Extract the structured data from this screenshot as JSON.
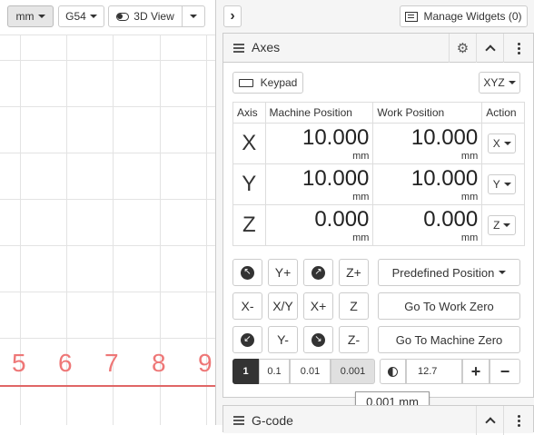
{
  "toolbar": {
    "units": "mm",
    "wcs": "G54",
    "view": "3D View"
  },
  "viewport": {
    "axis_numbers": [
      "5",
      "6",
      "7",
      "8",
      "9"
    ]
  },
  "panel_toggle": "›",
  "manage_widgets": "Manage Widgets (0)",
  "axes_widget": {
    "title": "Axes",
    "keypad": "Keypad",
    "axis_select": "XYZ",
    "table": {
      "headers": [
        "Axis",
        "Machine Position",
        "Work Position",
        "Action"
      ],
      "rows": [
        {
          "axis": "X",
          "machine": "10.000",
          "work": "10.000",
          "unit": "mm",
          "action": "X"
        },
        {
          "axis": "Y",
          "machine": "10.000",
          "work": "10.000",
          "unit": "mm",
          "action": "Y"
        },
        {
          "axis": "Z",
          "machine": "0.000",
          "work": "0.000",
          "unit": "mm",
          "action": "Z"
        }
      ]
    },
    "jog": {
      "y_plus": "Y+",
      "z_plus": "Z+",
      "x_minus": "X-",
      "xy": "X/Y",
      "x_plus": "X+",
      "z": "Z",
      "y_minus": "Y-",
      "z_minus": "Z-"
    },
    "predefined": "Predefined Position",
    "go_work_zero": "Go To Work Zero",
    "go_machine_zero": "Go To Machine Zero",
    "step": {
      "options": [
        "1",
        "0.1",
        "0.01",
        "0.001"
      ],
      "selected": "0.001",
      "custom": "12.7",
      "plus": "+",
      "minus": "−"
    },
    "tooltip": "0.001 mm"
  },
  "gcode_widget": {
    "title": "G-code"
  },
  "colors": {
    "axis_line": "#e06666",
    "axis_label": "#ee7777",
    "active_step": "#333333",
    "selected_step": "#e0e0e0"
  }
}
